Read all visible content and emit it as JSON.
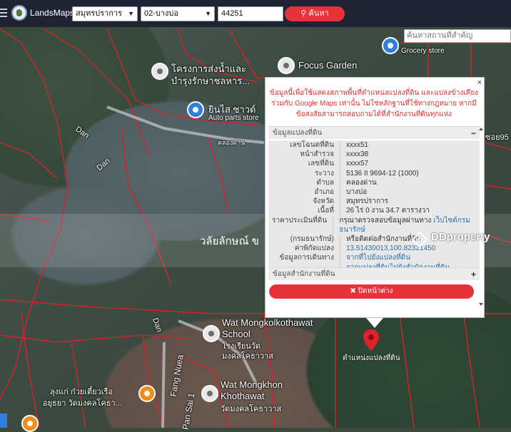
{
  "header": {
    "brand": "LandsMaps",
    "province": "สมุทรปราการ",
    "district": "02-บางบ่อ",
    "code_value": "44251",
    "search_label": "ค้นหา"
  },
  "place_search": {
    "placeholder": "ค้นหาสถานที่สำคัญ"
  },
  "map_labels": {
    "poi1": "โครงการส่งน้ำและ",
    "poi1b": "บำรุงรักษาชลหาร...",
    "focus_garden": "Focus Garden",
    "auto_parts_th": "ยินไส ซาวด์",
    "auto_parts": "Auto parts store",
    "grocery": "Grocery store",
    "road_dan1": "Dan",
    "road_dan2": "Dan",
    "road_dan3": "Dan",
    "road_num": "ซอย95",
    "road_khlong": "คลองด่าน",
    "wat1a": "Wat Mongkolkothawat",
    "wat1b": "School",
    "wat1c": "โรงเรียนวัด",
    "wat1d": "มงคลโคธาวาส",
    "wat2a": "Wat Mongkhon",
    "wat2b": "Khothawat",
    "wat2c": "วัดมงคลโคธาวาส",
    "noodle1": "ลุงแก่ ก๋วยเตี๋ยวเรือ",
    "noodle2": "อยุธยา วัดมงคลโคธา...",
    "road_vertical": "Fang Nuea",
    "road_vertical2": "Pan Sai 1",
    "watermark": "วลัยลักษณ์ ข",
    "ddproperty": "DDproperty",
    "pin_label": "ตำแหน่งแปลงที่ดิน"
  },
  "popup": {
    "close_x": "×",
    "note": "ข้อมูลนี้เพื่อใช้แสดงสภาพพื้นที่ตำแหน่งแปลงที่ดิน และแปลงข้างเคียงร่วมกับ Google Maps เท่านั้น ไม่ใช่หลักฐานที่ใช้ทางกฎหมาย หากมีข้อสงสัยสามารถสอบถามได้ที่สำนักงานที่ดินทุกแห่ง",
    "section1_title": "ข้อมูลแปลงที่ดิน",
    "section1_toggle": "−",
    "rows": [
      {
        "k": "เลขโฉนดที่ดิน",
        "v": "xxxx51"
      },
      {
        "k": "หน้าสำรวจ",
        "v": "xxxx38"
      },
      {
        "k": "เลขที่ดิน",
        "v": "xxxx57"
      },
      {
        "k": "ระวาง",
        "v": "5136 II 9694-12 (1000)"
      },
      {
        "k": "ตำบล",
        "v": "คลองด่าน"
      },
      {
        "k": "อำเภอ",
        "v": "บางบ่อ"
      },
      {
        "k": "จังหวัด",
        "v": "สมุทรปราการ"
      },
      {
        "k": "เนื้อที่",
        "v": "26 ไร่ 0 งาน 34.7 ตารางวา"
      }
    ],
    "price_k1": "ราคาประเมินที่ดิน",
    "price_k2": "(กรมธนารักษ์)",
    "price_v1": "กรุณาตรวจสอบข้อมูลผ่านทาง ",
    "price_link": "เว็บไซต์กรมธนารักษ์",
    "price_v2": "หรือติดต่อสำนักงานที่ดิน",
    "coord_k": "ค่าพิกัดแปลง",
    "coord_v": "13.51430013,100.82321450",
    "travel_k": "ข้อมูลการเดินทาง",
    "travel_v1": "จากที่ไปยังแปลงที่ดิน",
    "travel_v2": "จากแปลงที่ดินไปยังสำนักงานที่ดิน",
    "section2_title": "ข้อมูลสำนักงานที่ดิน",
    "section2_toggle": "+",
    "close_button": "ปิดหน้าต่าง"
  }
}
